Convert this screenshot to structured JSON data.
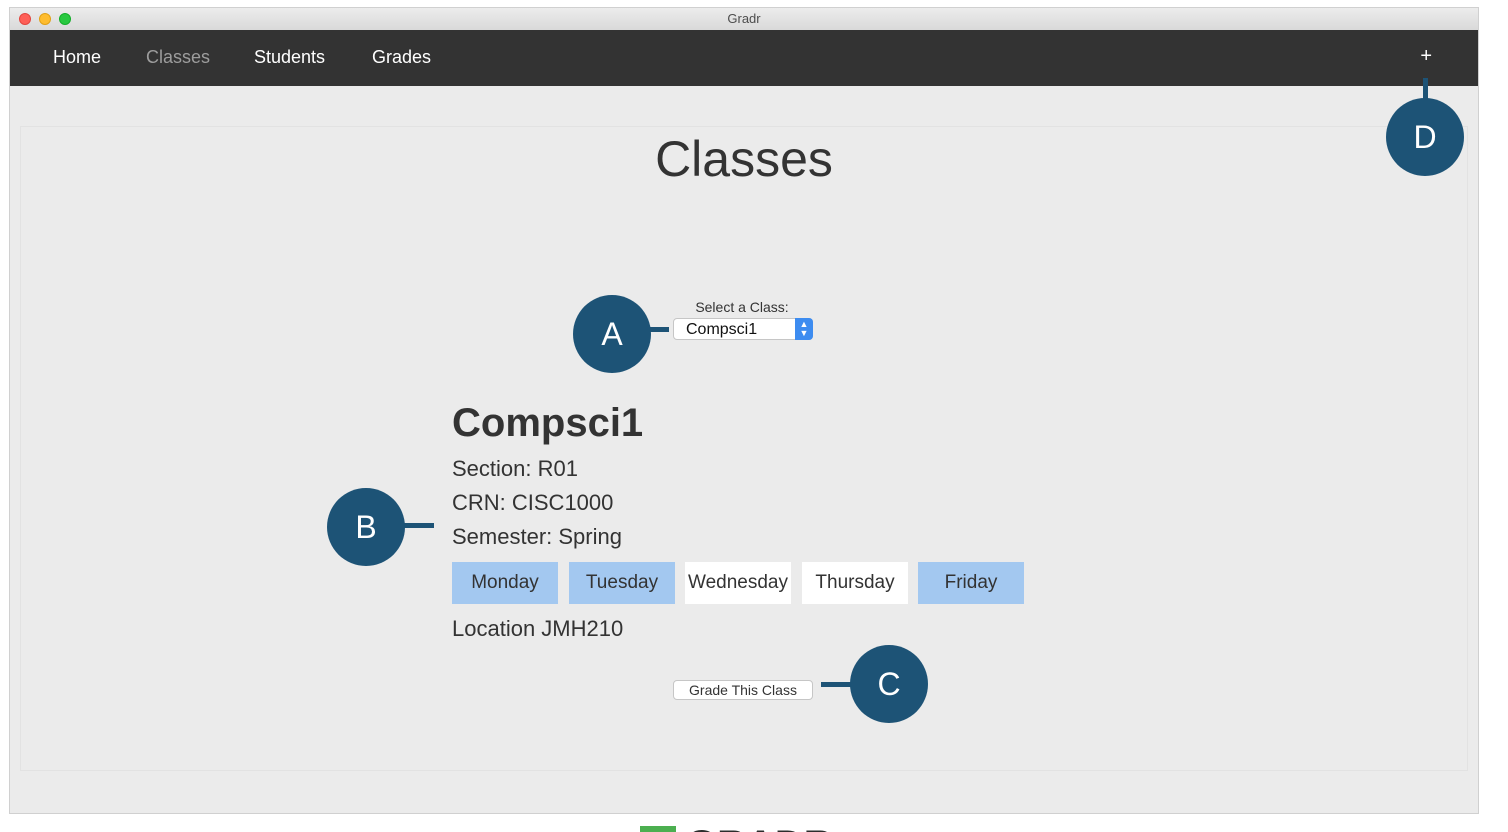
{
  "window": {
    "title": "Gradr"
  },
  "nav": {
    "items": [
      {
        "label": "Home"
      },
      {
        "label": "Classes"
      },
      {
        "label": "Students"
      },
      {
        "label": "Grades"
      }
    ],
    "add_label": "+"
  },
  "page": {
    "title": "Classes"
  },
  "select": {
    "label": "Select a Class:",
    "value": "Compsci1"
  },
  "class_info": {
    "name": "Compsci1",
    "section": "Section: R01",
    "crn": "CRN: CISC1000",
    "semester": "Semester: Spring",
    "location": "Location JMH210",
    "days": [
      {
        "label": "Monday",
        "active": true
      },
      {
        "label": "Tuesday",
        "active": true
      },
      {
        "label": "Wednesday",
        "active": false
      },
      {
        "label": "Thursday",
        "active": false
      },
      {
        "label": "Friday",
        "active": true
      }
    ]
  },
  "grade_button": {
    "label": "Grade This Class"
  },
  "callouts": {
    "a": "A",
    "b": "B",
    "c": "C",
    "d": "D"
  },
  "footer": {
    "logo_text": "GRADR"
  },
  "colors": {
    "navbar": "#333333",
    "active_day": "#a3c8f0",
    "callout": "#1d5376"
  }
}
